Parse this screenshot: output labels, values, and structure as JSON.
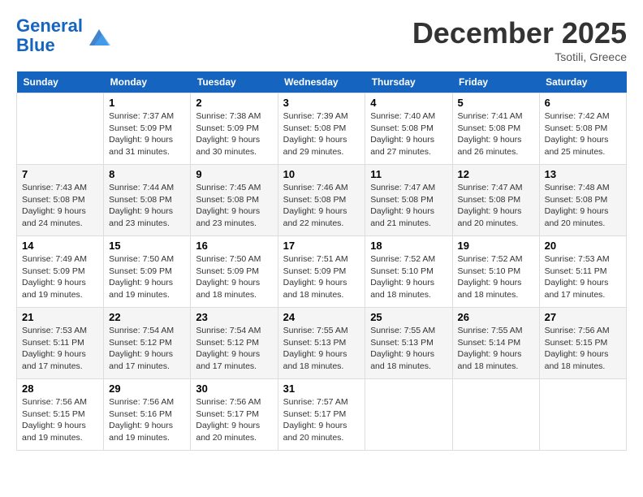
{
  "header": {
    "logo_line1": "General",
    "logo_line2": "Blue",
    "month_title": "December 2025",
    "location": "Tsotili, Greece"
  },
  "weekdays": [
    "Sunday",
    "Monday",
    "Tuesday",
    "Wednesday",
    "Thursday",
    "Friday",
    "Saturday"
  ],
  "weeks": [
    [
      {
        "day": "",
        "sunrise": "",
        "sunset": "",
        "daylight": ""
      },
      {
        "day": "1",
        "sunrise": "Sunrise: 7:37 AM",
        "sunset": "Sunset: 5:09 PM",
        "daylight": "Daylight: 9 hours and 31 minutes."
      },
      {
        "day": "2",
        "sunrise": "Sunrise: 7:38 AM",
        "sunset": "Sunset: 5:09 PM",
        "daylight": "Daylight: 9 hours and 30 minutes."
      },
      {
        "day": "3",
        "sunrise": "Sunrise: 7:39 AM",
        "sunset": "Sunset: 5:08 PM",
        "daylight": "Daylight: 9 hours and 29 minutes."
      },
      {
        "day": "4",
        "sunrise": "Sunrise: 7:40 AM",
        "sunset": "Sunset: 5:08 PM",
        "daylight": "Daylight: 9 hours and 27 minutes."
      },
      {
        "day": "5",
        "sunrise": "Sunrise: 7:41 AM",
        "sunset": "Sunset: 5:08 PM",
        "daylight": "Daylight: 9 hours and 26 minutes."
      },
      {
        "day": "6",
        "sunrise": "Sunrise: 7:42 AM",
        "sunset": "Sunset: 5:08 PM",
        "daylight": "Daylight: 9 hours and 25 minutes."
      }
    ],
    [
      {
        "day": "7",
        "sunrise": "Sunrise: 7:43 AM",
        "sunset": "Sunset: 5:08 PM",
        "daylight": "Daylight: 9 hours and 24 minutes."
      },
      {
        "day": "8",
        "sunrise": "Sunrise: 7:44 AM",
        "sunset": "Sunset: 5:08 PM",
        "daylight": "Daylight: 9 hours and 23 minutes."
      },
      {
        "day": "9",
        "sunrise": "Sunrise: 7:45 AM",
        "sunset": "Sunset: 5:08 PM",
        "daylight": "Daylight: 9 hours and 23 minutes."
      },
      {
        "day": "10",
        "sunrise": "Sunrise: 7:46 AM",
        "sunset": "Sunset: 5:08 PM",
        "daylight": "Daylight: 9 hours and 22 minutes."
      },
      {
        "day": "11",
        "sunrise": "Sunrise: 7:47 AM",
        "sunset": "Sunset: 5:08 PM",
        "daylight": "Daylight: 9 hours and 21 minutes."
      },
      {
        "day": "12",
        "sunrise": "Sunrise: 7:47 AM",
        "sunset": "Sunset: 5:08 PM",
        "daylight": "Daylight: 9 hours and 20 minutes."
      },
      {
        "day": "13",
        "sunrise": "Sunrise: 7:48 AM",
        "sunset": "Sunset: 5:08 PM",
        "daylight": "Daylight: 9 hours and 20 minutes."
      }
    ],
    [
      {
        "day": "14",
        "sunrise": "Sunrise: 7:49 AM",
        "sunset": "Sunset: 5:09 PM",
        "daylight": "Daylight: 9 hours and 19 minutes."
      },
      {
        "day": "15",
        "sunrise": "Sunrise: 7:50 AM",
        "sunset": "Sunset: 5:09 PM",
        "daylight": "Daylight: 9 hours and 19 minutes."
      },
      {
        "day": "16",
        "sunrise": "Sunrise: 7:50 AM",
        "sunset": "Sunset: 5:09 PM",
        "daylight": "Daylight: 9 hours and 18 minutes."
      },
      {
        "day": "17",
        "sunrise": "Sunrise: 7:51 AM",
        "sunset": "Sunset: 5:09 PM",
        "daylight": "Daylight: 9 hours and 18 minutes."
      },
      {
        "day": "18",
        "sunrise": "Sunrise: 7:52 AM",
        "sunset": "Sunset: 5:10 PM",
        "daylight": "Daylight: 9 hours and 18 minutes."
      },
      {
        "day": "19",
        "sunrise": "Sunrise: 7:52 AM",
        "sunset": "Sunset: 5:10 PM",
        "daylight": "Daylight: 9 hours and 18 minutes."
      },
      {
        "day": "20",
        "sunrise": "Sunrise: 7:53 AM",
        "sunset": "Sunset: 5:11 PM",
        "daylight": "Daylight: 9 hours and 17 minutes."
      }
    ],
    [
      {
        "day": "21",
        "sunrise": "Sunrise: 7:53 AM",
        "sunset": "Sunset: 5:11 PM",
        "daylight": "Daylight: 9 hours and 17 minutes."
      },
      {
        "day": "22",
        "sunrise": "Sunrise: 7:54 AM",
        "sunset": "Sunset: 5:12 PM",
        "daylight": "Daylight: 9 hours and 17 minutes."
      },
      {
        "day": "23",
        "sunrise": "Sunrise: 7:54 AM",
        "sunset": "Sunset: 5:12 PM",
        "daylight": "Daylight: 9 hours and 17 minutes."
      },
      {
        "day": "24",
        "sunrise": "Sunrise: 7:55 AM",
        "sunset": "Sunset: 5:13 PM",
        "daylight": "Daylight: 9 hours and 18 minutes."
      },
      {
        "day": "25",
        "sunrise": "Sunrise: 7:55 AM",
        "sunset": "Sunset: 5:13 PM",
        "daylight": "Daylight: 9 hours and 18 minutes."
      },
      {
        "day": "26",
        "sunrise": "Sunrise: 7:55 AM",
        "sunset": "Sunset: 5:14 PM",
        "daylight": "Daylight: 9 hours and 18 minutes."
      },
      {
        "day": "27",
        "sunrise": "Sunrise: 7:56 AM",
        "sunset": "Sunset: 5:15 PM",
        "daylight": "Daylight: 9 hours and 18 minutes."
      }
    ],
    [
      {
        "day": "28",
        "sunrise": "Sunrise: 7:56 AM",
        "sunset": "Sunset: 5:15 PM",
        "daylight": "Daylight: 9 hours and 19 minutes."
      },
      {
        "day": "29",
        "sunrise": "Sunrise: 7:56 AM",
        "sunset": "Sunset: 5:16 PM",
        "daylight": "Daylight: 9 hours and 19 minutes."
      },
      {
        "day": "30",
        "sunrise": "Sunrise: 7:56 AM",
        "sunset": "Sunset: 5:17 PM",
        "daylight": "Daylight: 9 hours and 20 minutes."
      },
      {
        "day": "31",
        "sunrise": "Sunrise: 7:57 AM",
        "sunset": "Sunset: 5:17 PM",
        "daylight": "Daylight: 9 hours and 20 minutes."
      },
      {
        "day": "",
        "sunrise": "",
        "sunset": "",
        "daylight": ""
      },
      {
        "day": "",
        "sunrise": "",
        "sunset": "",
        "daylight": ""
      },
      {
        "day": "",
        "sunrise": "",
        "sunset": "",
        "daylight": ""
      }
    ]
  ]
}
